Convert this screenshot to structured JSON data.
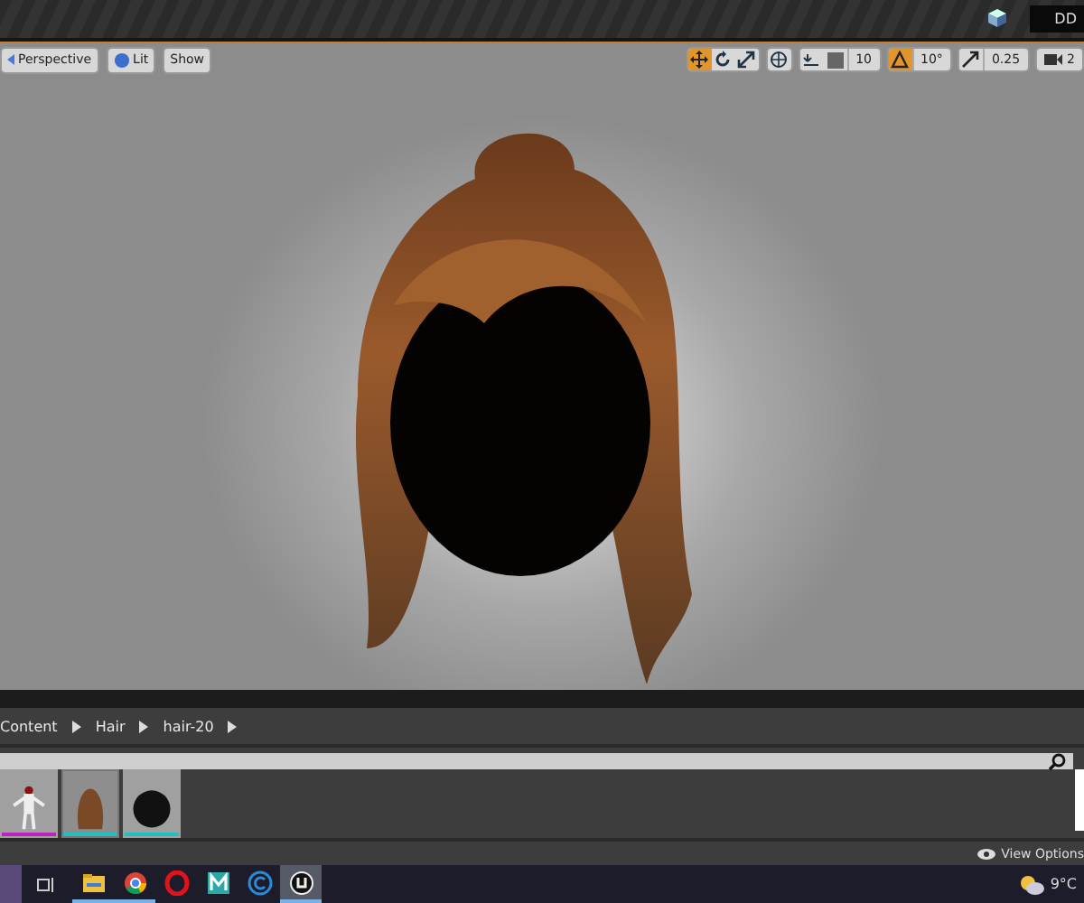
{
  "top_bar": {
    "text": "DD"
  },
  "viewport": {
    "buttons": [
      {
        "kind": "perspective",
        "label": "Perspective"
      },
      {
        "kind": "lit",
        "label": "Lit"
      },
      {
        "kind": "show",
        "label": "Show"
      }
    ],
    "transform_tools": [
      {
        "kind": "move",
        "selected": true
      },
      {
        "kind": "rotate",
        "selected": false
      },
      {
        "kind": "scale",
        "selected": false
      }
    ],
    "grid_snap": {
      "on": false,
      "value": "10"
    },
    "rotation_snap": {
      "on": true,
      "value": "10°"
    },
    "scale_snap": {
      "value": "0.25"
    },
    "camera_speed": "2"
  },
  "content_browser": {
    "breadcrumbs": [
      "Content",
      "Hair",
      "hair-20"
    ],
    "assets": [
      {
        "kind": "character",
        "color": "#c020c0",
        "selected": false
      },
      {
        "kind": "hair",
        "color": "#20c0c0",
        "selected": true
      },
      {
        "kind": "sphere",
        "color": "#20c0c0",
        "selected": false
      }
    ],
    "view_options": "View Options"
  },
  "taskbar": {
    "apps": [
      {
        "kind": "explorer",
        "open": true,
        "selected": false
      },
      {
        "kind": "chrome",
        "open": true,
        "selected": false
      },
      {
        "kind": "opera",
        "open": false,
        "selected": false
      },
      {
        "kind": "maya",
        "open": false,
        "selected": false
      },
      {
        "kind": "c",
        "open": false,
        "selected": false
      },
      {
        "kind": "unreal",
        "open": true,
        "selected": true
      }
    ],
    "weather": "9°C"
  }
}
